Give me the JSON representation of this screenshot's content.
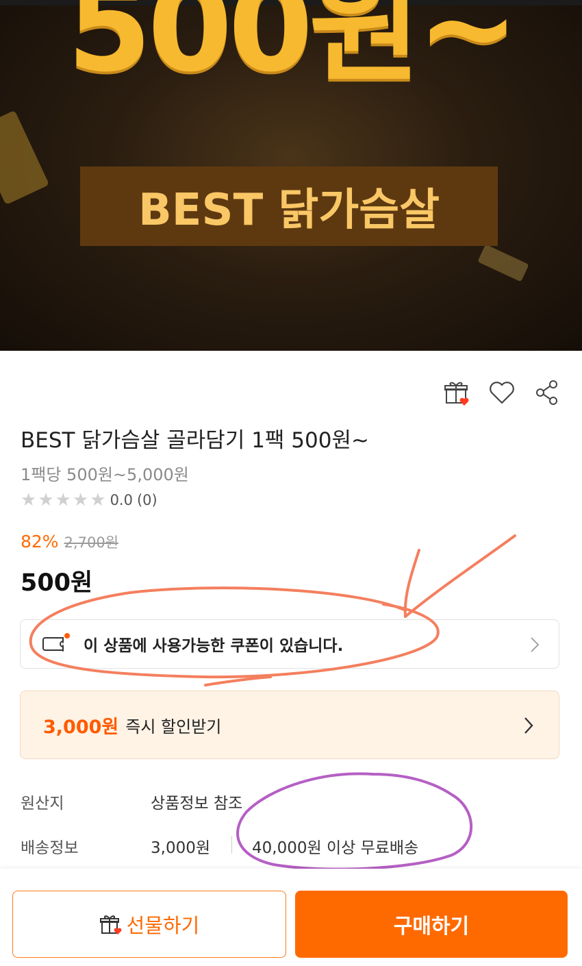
{
  "banner": {
    "price_text": "500원~",
    "label_text": "BEST 닭가슴살"
  },
  "actions": {
    "icons": [
      "gift-icon",
      "heart-icon",
      "share-icon"
    ]
  },
  "product": {
    "title": "BEST 닭가슴살 골라담기 1팩 500원~",
    "subtitle": "1팩당 500원~5,000원",
    "rating": "0.0",
    "rating_count": "(0)",
    "stars_filled": 0,
    "stars_total": 5,
    "discount_rate": "82%",
    "original_price": "2,700원",
    "price": "500원"
  },
  "coupon": {
    "text": "이 상품에 사용가능한 쿠폰이 있습니다."
  },
  "instant_discount": {
    "amount": "3,000원",
    "text": "즉시 할인받기"
  },
  "info": {
    "origin_label": "원산지",
    "origin_value": "상품정보 참조",
    "shipping_label": "배송정보",
    "shipping_fee": "3,000원",
    "free_shipping": "40,000원 이상 무료배송"
  },
  "bottom": {
    "gift_label": "선물하기",
    "buy_label": "구매하기"
  },
  "colors": {
    "accent": "#ff6a00",
    "banner_gold": "#f7b92f",
    "annotation_orange": "#f47f5e",
    "annotation_purple": "#b55fc4"
  }
}
